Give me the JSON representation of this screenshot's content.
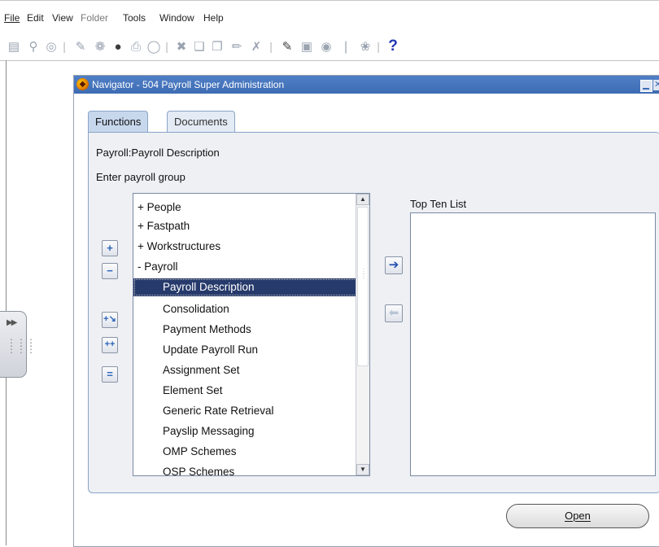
{
  "menu": {
    "items": [
      {
        "label": "File",
        "enabled": true
      },
      {
        "label": "Edit",
        "enabled": true
      },
      {
        "label": "View",
        "enabled": true
      },
      {
        "label": "Folder",
        "enabled": false
      },
      {
        "label": "Tools",
        "enabled": true
      },
      {
        "label": "Window",
        "enabled": true
      },
      {
        "label": "Help",
        "enabled": true
      }
    ]
  },
  "toolbar": {
    "icons": [
      "new-icon",
      "find-icon",
      "navigator-icon",
      "save-icon",
      "next-step-icon",
      "switch-responsibility-icon",
      "print-icon",
      "close-form-icon",
      "cut-icon",
      "copy-icon",
      "paste-icon",
      "new-record-icon",
      "delete-record-icon",
      "edit-field-icon",
      "zoom-icon",
      "translations-icon",
      "attachments-icon",
      "folder-tools-icon",
      "help-icon"
    ],
    "help_glyph": "?"
  },
  "navigator": {
    "title": "Navigator - 504 Payroll Super Administration",
    "tabs": [
      {
        "label": "Functions",
        "active": true
      },
      {
        "label": "Documents",
        "active": false
      }
    ],
    "path_label": "Payroll:Payroll Description",
    "prompt_label": "Enter payroll group",
    "list_items": [
      {
        "label": "+ People",
        "level": 0,
        "selected": false
      },
      {
        "label": "+ Fastpath",
        "level": 0,
        "selected": false
      },
      {
        "label": "+ Workstructures",
        "level": 0,
        "selected": false
      },
      {
        "label": "- Payroll",
        "level": 0,
        "selected": false
      },
      {
        "label": "Payroll Description",
        "level": 1,
        "selected": true
      },
      {
        "label": "Consolidation",
        "level": 1,
        "selected": false
      },
      {
        "label": "Payment Methods",
        "level": 1,
        "selected": false
      },
      {
        "label": "Update Payroll Run",
        "level": 1,
        "selected": false
      },
      {
        "label": "Assignment Set",
        "level": 1,
        "selected": false
      },
      {
        "label": "Element Set",
        "level": 1,
        "selected": false
      },
      {
        "label": "Generic Rate Retrieval",
        "level": 1,
        "selected": false
      },
      {
        "label": "Payslip Messaging",
        "level": 1,
        "selected": false
      },
      {
        "label": "OMP Schemes",
        "level": 1,
        "selected": false
      },
      {
        "label": "OSP Schemes",
        "level": 1,
        "selected": false
      }
    ],
    "top_ten_label": "Top Ten List",
    "open_button_label": "Open"
  }
}
